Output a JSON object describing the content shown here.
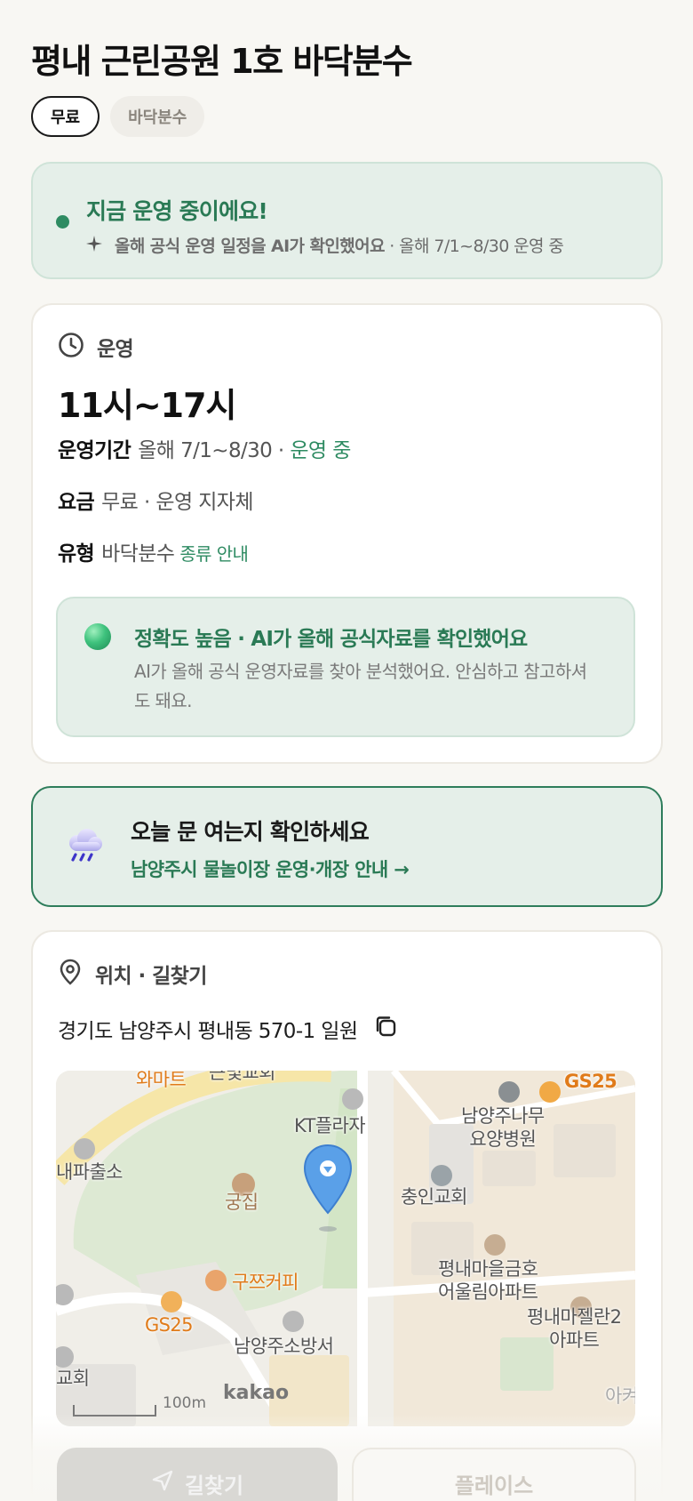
{
  "header": {
    "title": "평내 근린공원 1호 바닥분수",
    "chips": [
      "무료",
      "바닥분수"
    ]
  },
  "status": {
    "title": "지금 운영 중이에요!",
    "sub_bold": "올해 공식 운영 일정을 AI가 확인했어요",
    "sub_rest": " · 올해 7/1~8/30 운영 중"
  },
  "operation": {
    "section_label": "운영",
    "hours": "11시~17시",
    "period_key": "운영기간",
    "period_value": "올해 7/1~8/30 · ",
    "period_status": "운영 중",
    "fee_key": "요금",
    "fee_value": "무료 · 운영 지자체",
    "type_key": "유형",
    "type_value": "바닥분수",
    "type_link": "종류 안내",
    "accuracy_title": "정확도 높음 · AI가 올해 공식자료를 확인했어요",
    "accuracy_body": "AI가 올해 공식 운영자료를 찾아 분석했어요. 안심하고 참고하셔도 돼요."
  },
  "notice": {
    "title": "오늘 문 여는지 확인하세요",
    "link": "남양주시 물놀이장 운영·개장 안내 →"
  },
  "location": {
    "section_label": "위치 · 길찾기",
    "address": "경기도 남양주시 평내동 570-1 일원",
    "map_labels": {
      "wamart": "와마트",
      "church_top": "큰빛교회",
      "kt": "KT플라자",
      "gs25_top": "GS25",
      "hospital_1": "남양주나무",
      "hospital_2": "요양병원",
      "police": "내파출소",
      "gungjip": "궁집",
      "chungin": "충인교회",
      "apt1_1": "평내마을금호",
      "apt1_2": "어울림아파트",
      "coffee": "구쯔커피",
      "gs25_bottom": "GS25",
      "fire": "남양주소방서",
      "apt2_1": "평내마젤란2",
      "apt2_2": "아파트",
      "church_left": "교회",
      "scale": "100m",
      "kakao": "kakao",
      "right_edge": "아켜"
    }
  },
  "actions": {
    "directions": "길찾기",
    "place": "플레이스"
  },
  "colors": {
    "accent_green": "#2a7a55",
    "card_green_bg": "#e5efe9",
    "background": "#f8f7f3"
  }
}
